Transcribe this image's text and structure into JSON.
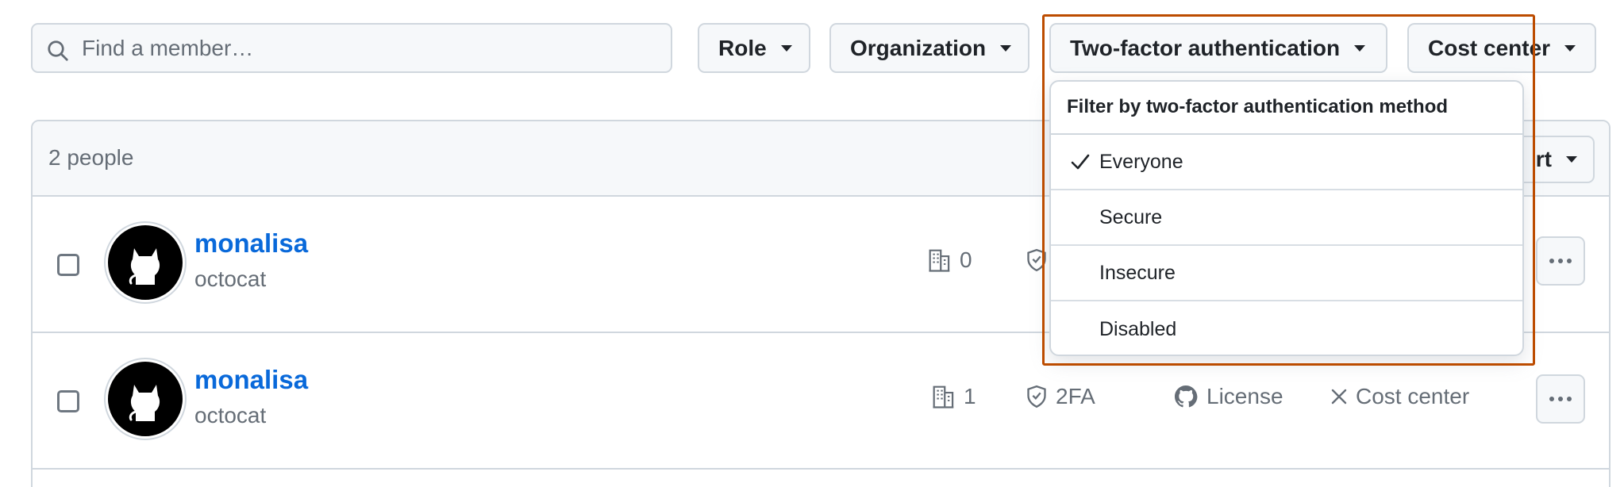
{
  "search": {
    "placeholder": "Find a member…",
    "icon": "search-icon"
  },
  "filters": {
    "role": "Role",
    "organization": "Organization",
    "two_factor": "Two-factor authentication",
    "cost_center": "Cost center"
  },
  "table": {
    "count_label": "2 people",
    "sort_label": "rt"
  },
  "rows": [
    {
      "name": "monalisa",
      "login": "octocat",
      "org_count": "0"
    },
    {
      "name": "monalisa",
      "login": "octocat",
      "org_count": "1",
      "twofa": "2FA",
      "license": "License",
      "cost_center": "Cost center"
    }
  ],
  "dropdown": {
    "title": "Filter by two-factor authentication method",
    "items": [
      {
        "label": "Everyone",
        "selected": true
      },
      {
        "label": "Secure",
        "selected": false
      },
      {
        "label": "Insecure",
        "selected": false
      },
      {
        "label": "Disabled",
        "selected": false
      }
    ]
  },
  "colors": {
    "highlight": "#bc4c00",
    "link": "#0969da"
  }
}
